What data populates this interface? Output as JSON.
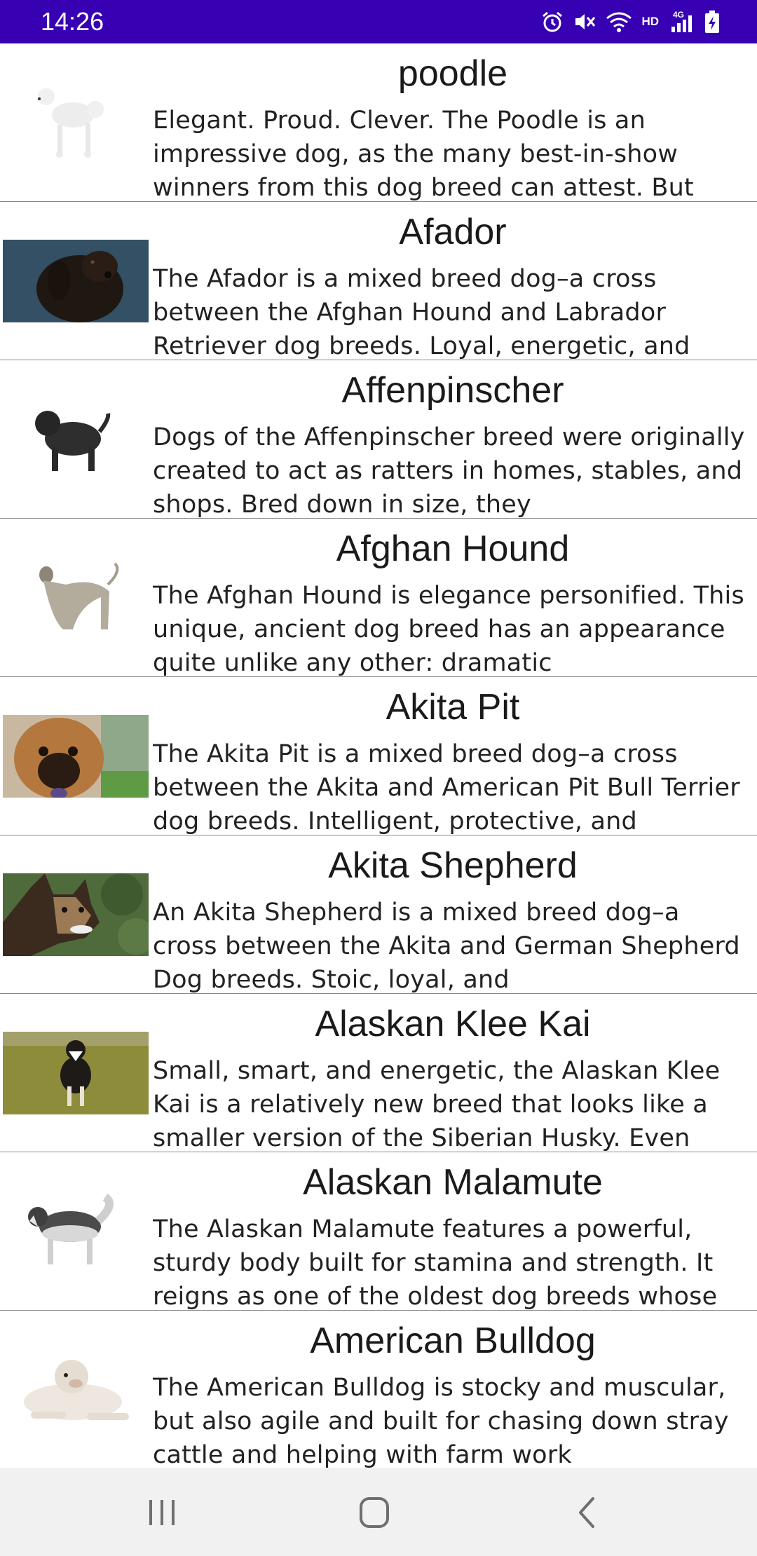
{
  "status": {
    "time": "14:26",
    "hd": "HD",
    "network": "4G"
  },
  "breeds": [
    {
      "name": "poodle",
      "description": "Elegant. Proud. Clever. The Poodle is an impressive dog, as the many best-in-show winners from this dog breed can attest. But"
    },
    {
      "name": "Afador",
      "description": "The Afador is a mixed breed dog–a cross between the Afghan Hound and Labrador Retriever dog breeds. Loyal, energetic, and"
    },
    {
      "name": "Affenpinscher",
      "description": "Dogs of the Affenpinscher breed were originally created to act as ratters in homes, stables, and shops. Bred down in size, they"
    },
    {
      "name": "Afghan Hound",
      "description": "The Afghan Hound is elegance personified. This unique, ancient dog breed has an appearance quite unlike any other: dramatic"
    },
    {
      "name": "Akita Pit",
      "description": "The Akita Pit is a mixed breed dog–a cross between the Akita and American Pit Bull Terrier dog breeds. Intelligent, protective, and"
    },
    {
      "name": "Akita Shepherd",
      "description": "An Akita Shepherd is a mixed breed dog–a cross between the Akita and German Shepherd Dog breeds. Stoic, loyal, and"
    },
    {
      "name": "Alaskan Klee Kai",
      "description": "Small, smart, and energetic, the Alaskan Klee Kai is a relatively new breed that looks like a smaller version of the Siberian Husky. Even"
    },
    {
      "name": "Alaskan Malamute",
      "description": "The Alaskan Malamute features a powerful, sturdy body built for stamina and strength. It reigns as one of the oldest dog breeds whose"
    },
    {
      "name": "American Bulldog",
      "description": "The American Bulldog is stocky and muscular, but also agile and built for chasing down stray cattle and helping with farm work"
    }
  ],
  "colors": {
    "status_bar": "#3700b3",
    "nav_bar": "#f1f1f1",
    "divider": "#8a8a8a"
  },
  "icons": {
    "status": [
      "alarm-icon",
      "mute-icon",
      "wifi-icon",
      "signal-icon",
      "battery-charging-icon"
    ],
    "nav": [
      "recents-icon",
      "home-icon",
      "back-icon"
    ]
  }
}
